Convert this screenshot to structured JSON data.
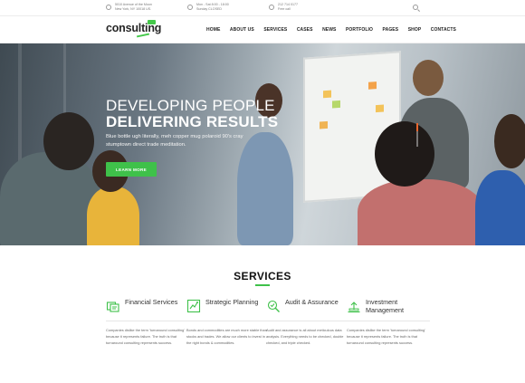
{
  "topbar": {
    "address": {
      "line1": "5010 Avenue of the Moon",
      "line2": "New York, NY 10018 US."
    },
    "hours": {
      "line1": "Mon - Sat 8:00 - 18:00",
      "line2": "Sunday CLOSED"
    },
    "phone": {
      "line1": "212 714 0177",
      "line2": "Free call"
    },
    "icons": [
      "location-icon",
      "clock-icon",
      "phone-icon",
      "search-icon"
    ]
  },
  "nav": {
    "logo": "consulting",
    "items": [
      "HOME",
      "ABOUT US",
      "SERVICES",
      "CASES",
      "NEWS",
      "PORTFOLIO",
      "PAGES",
      "SHOP",
      "CONTACTS"
    ]
  },
  "hero": {
    "title_line1": "DEVELOPING PEOPLE",
    "title_line2": "DELIVERING RESULTS",
    "text": "Blue bottle ugh literally, meh copper mug polaroid 90's cray stumptown direct trade meditation.",
    "button": "LEARN MORE"
  },
  "services": {
    "title": "SERVICES",
    "cards": [
      {
        "name": "Financial Services",
        "icon": "financial-icon",
        "desc": "Companies dislike the term 'turnaround consulting' because it represents failure. The truth is that turnaround consulting represents success."
      },
      {
        "name": "Strategic Planning",
        "icon": "strategy-icon",
        "desc": "Bonds and commodities are much more stable than stocks and trades. We allow our clients to invest in the right bonds & commodities."
      },
      {
        "name": "Audit & Assurance",
        "icon": "audit-icon",
        "desc": "Audit and assurance is all about meticulous data analysis. Everything needs to be checked, double checked, and triple checked."
      },
      {
        "name": "Investment Management",
        "icon": "investment-icon",
        "desc": "Companies dislike the term 'turnaround consulting' because it represents failure. The truth is that turnaround consulting represents success."
      }
    ]
  },
  "colors": {
    "accent": "#3fc14a",
    "slider_accent": "#e8662e",
    "text_dark": "#222222"
  }
}
